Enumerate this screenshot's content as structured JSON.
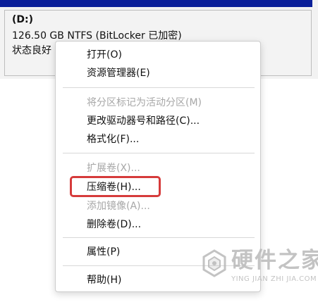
{
  "volume": {
    "title": "(D:)",
    "info": "126.50 GB NTFS (BitLocker 已加密)",
    "status": "状态良好"
  },
  "context_menu": {
    "items": [
      {
        "label": "打开(O)",
        "enabled": true
      },
      {
        "label": "资源管理器(E)",
        "enabled": true
      },
      {
        "label": "将分区标记为活动分区(M)",
        "enabled": false
      },
      {
        "label": "更改驱动器号和路径(C)...",
        "enabled": true
      },
      {
        "label": "格式化(F)...",
        "enabled": true
      },
      {
        "label": "扩展卷(X)...",
        "enabled": false
      },
      {
        "label": "压缩卷(H)...",
        "enabled": true
      },
      {
        "label": "添加镜像(A)...",
        "enabled": false
      },
      {
        "label": "删除卷(D)...",
        "enabled": true
      },
      {
        "label": "属性(P)",
        "enabled": true
      },
      {
        "label": "帮助(H)",
        "enabled": true
      }
    ]
  },
  "watermark": {
    "title": "硬件之家",
    "subtitle": "YING JIAN ZHI JIA.COM"
  },
  "colors": {
    "header_blue": "#0b1f99",
    "highlight_red": "#d63b3b",
    "disabled_gray": "#a7a7a7"
  }
}
